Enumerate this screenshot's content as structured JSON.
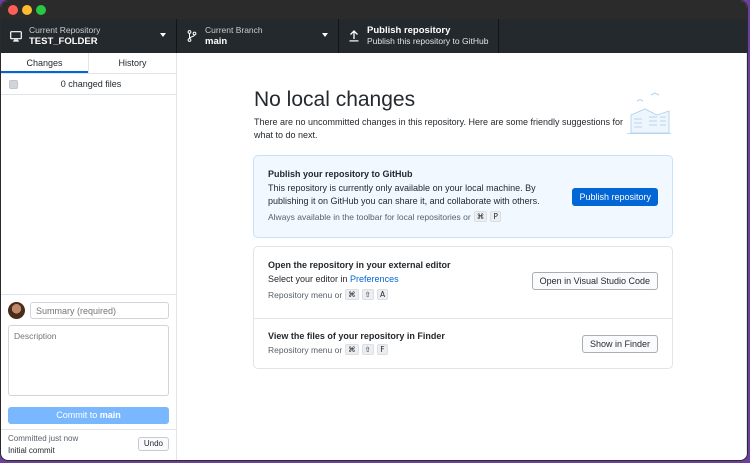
{
  "toolbar": {
    "repo_label": "Current Repository",
    "repo_value": "TEST_FOLDER",
    "branch_label": "Current Branch",
    "branch_value": "main",
    "publish_label": "Publish repository",
    "publish_sub": "Publish this repository to GitHub"
  },
  "sidebar": {
    "tabs": [
      {
        "label": "Changes",
        "active": true
      },
      {
        "label": "History",
        "active": false
      }
    ],
    "changed_files": "0 changed files",
    "summary_placeholder": "Summary (required)",
    "description_placeholder": "Description",
    "commit_prefix": "Commit to ",
    "commit_branch": "main",
    "last_commit_time": "Committed just now",
    "last_commit_message": "Initial commit",
    "undo_label": "Undo"
  },
  "main": {
    "heading": "No local changes",
    "intro": "There are no uncommitted changes in this repository. Here are some friendly suggestions for what to do next.",
    "publish_card": {
      "title": "Publish your repository to GitHub",
      "desc": "This repository is currently only available on your local machine. By publishing it on GitHub you can share it, and collaborate with others.",
      "hint": "Always available in the toolbar for local repositories or",
      "keys": [
        "⌘",
        "P"
      ],
      "button": "Publish repository"
    },
    "editor_card": {
      "title": "Open the repository in your external editor",
      "desc_prefix": "Select your editor in ",
      "desc_link": "Preferences",
      "hint": "Repository menu or",
      "keys": [
        "⌘",
        "⇧",
        "A"
      ],
      "button": "Open in Visual Studio Code"
    },
    "finder_card": {
      "title": "View the files of your repository in Finder",
      "hint": "Repository menu or",
      "keys": [
        "⌘",
        "⇧",
        "F"
      ],
      "button": "Show in Finder"
    }
  },
  "colors": {
    "accent": "#0366d6",
    "toolbar_bg": "#24292e",
    "commit_button": "#79b8ff"
  }
}
